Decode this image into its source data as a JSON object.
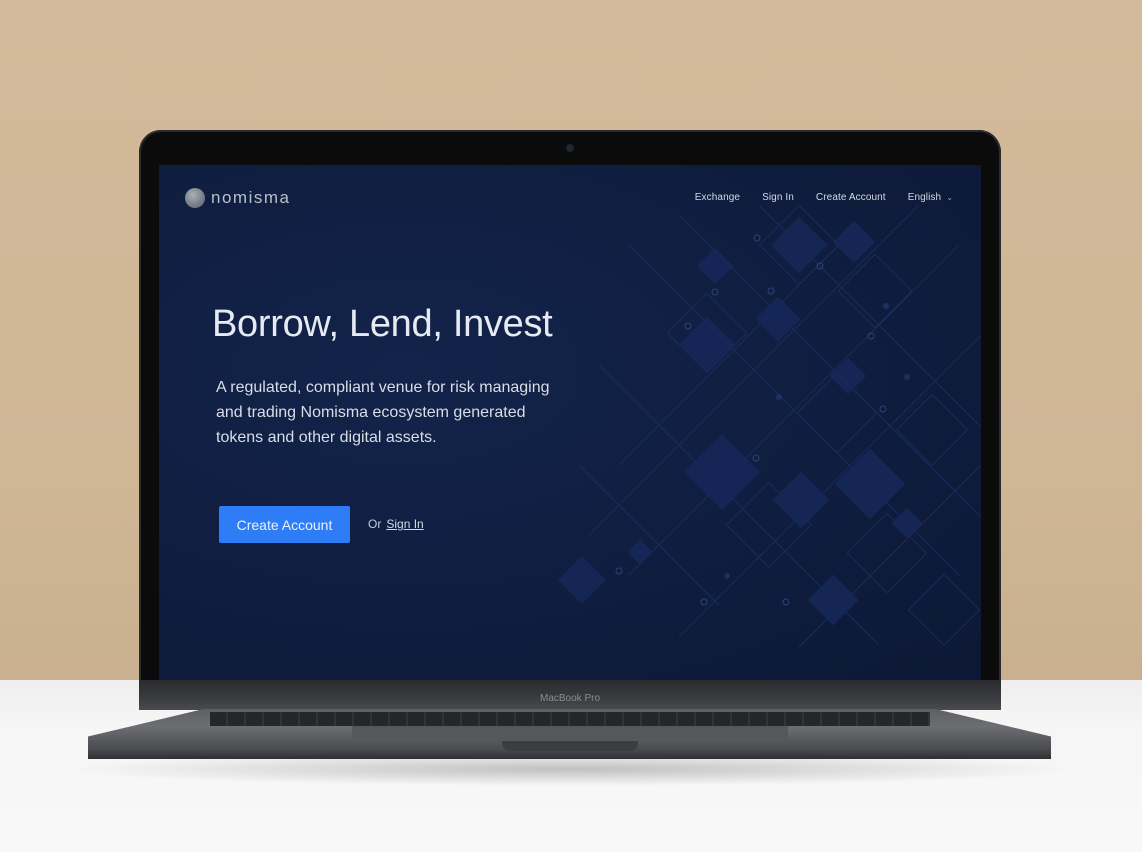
{
  "brand": {
    "name": "nomisma",
    "logo_icon": "nomisma-logo-icon"
  },
  "nav": {
    "items": [
      {
        "label": "Exchange"
      },
      {
        "label": "Sign In"
      },
      {
        "label": "Create Account"
      }
    ],
    "language": {
      "label": "English",
      "icon": "chevron-down-icon"
    }
  },
  "hero": {
    "title": "Borrow, Lend, Invest",
    "subtitle": "A regulated, compliant venue for risk managing and trading Nomisma ecosystem generated tokens and other digital assets.",
    "cta_label": "Create Account",
    "or_text": "Or",
    "signin_label": "Sign In"
  },
  "device": {
    "label": "MacBook Pro"
  },
  "colors": {
    "background_navy": "#0f1d3f",
    "cta_blue": "#2f7df6",
    "wall": "#d0b898",
    "desk": "#f4f4f4"
  }
}
